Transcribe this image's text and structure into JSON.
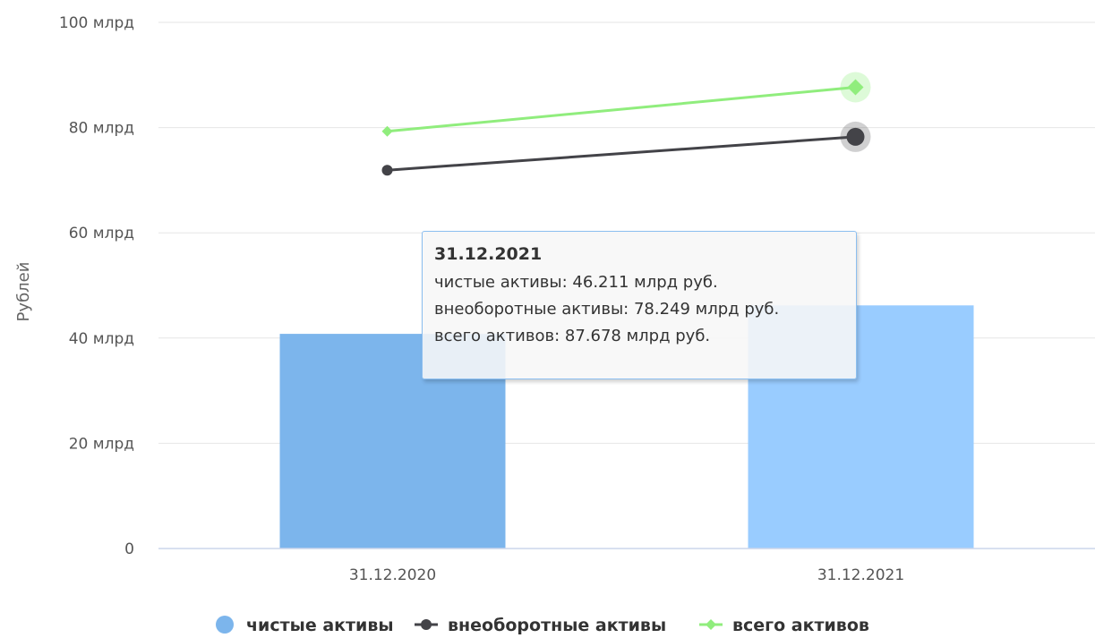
{
  "chart_data": {
    "type": "bar",
    "ylabel": "Рублей",
    "ylim": [
      0,
      100
    ],
    "y_ticks": [
      "0",
      "20 млрд",
      "40 млрд",
      "60 млрд",
      "80 млрд",
      "100 млрд"
    ],
    "y_tick_values": [
      0,
      20,
      40,
      60,
      80,
      100
    ],
    "categories": [
      "31.12.2020",
      "31.12.2021"
    ],
    "grid": true,
    "legend_position": "bottom",
    "series": [
      {
        "name": "чистые активы",
        "kind": "bar",
        "values": [
          40.8,
          46.211
        ],
        "colors": [
          "#7cb5ec",
          "#99ccff"
        ]
      },
      {
        "name": "внеоборотные активы",
        "kind": "line",
        "marker": "circle",
        "values": [
          71.9,
          78.249
        ],
        "color": "#434348"
      },
      {
        "name": "всего активов",
        "kind": "line",
        "marker": "diamond",
        "values": [
          79.3,
          87.678
        ],
        "color": "#90ed7d"
      }
    ],
    "tooltip": {
      "title": "31.12.2021",
      "rows": [
        "чистые активы: 46.211 млрд руб.",
        "внеоборотные активы: 78.249 млрд руб.",
        "всего активов: 87.678 млрд руб."
      ]
    }
  }
}
